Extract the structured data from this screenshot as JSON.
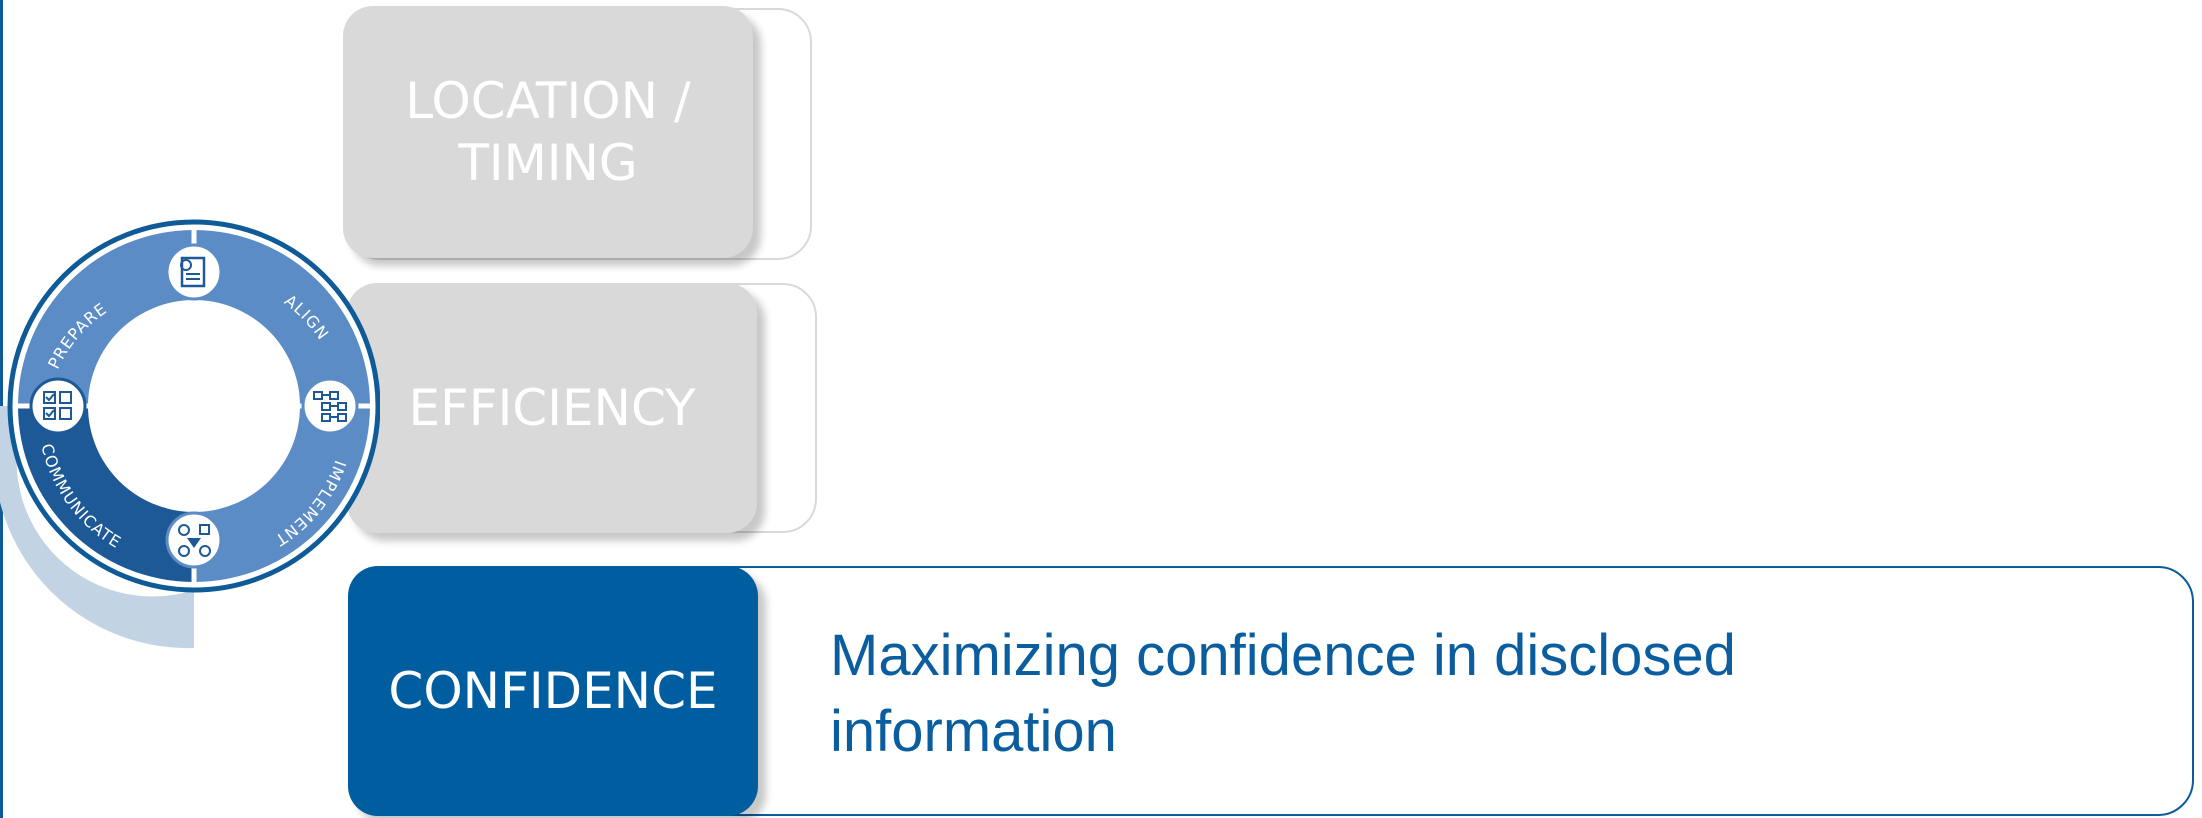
{
  "cards": [
    {
      "label": "LOCATION / TIMING",
      "line1": "LOCATION /",
      "line2": "TIMING",
      "state": "inactive"
    },
    {
      "label": "EFFICIENCY",
      "state": "inactive"
    },
    {
      "label": "CONFIDENCE",
      "state": "active",
      "description": "Maximizing confidence in disclosed information"
    }
  ],
  "cycle": {
    "stages": [
      "PREPARE",
      "ALIGN",
      "IMPLEMENT",
      "COMMUNICATE"
    ],
    "icons": [
      "document-review-icon",
      "process-flow-icon",
      "network-flow-icon",
      "checklist-grid-icon"
    ],
    "active_stage": "COMMUNICATE"
  },
  "colors": {
    "brand_blue": "#005ea0",
    "ring_light": "#5b8cc6",
    "ring_dark": "#1d5996",
    "ring_outline": "#0f5b97",
    "inactive_grey": "#d9d9d9",
    "arc_pale": "#c2d4e3"
  }
}
